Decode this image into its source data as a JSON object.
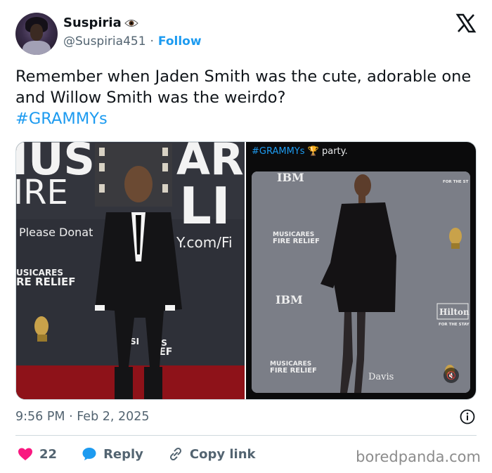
{
  "author": {
    "name": "Suspiria",
    "name_icon": "eye-icon",
    "handle": "@Suspiria451",
    "separator": "·",
    "follow_label": "Follow"
  },
  "tweet": {
    "text": "Remember when Jaden Smith was the cute, adorable one and Willow Smith was the weirdo?",
    "hashtag": "#GRAMMYs"
  },
  "media": {
    "left_photo": {
      "backdrop_texts": [
        "IUS",
        "ARE",
        "IRE",
        "LI",
        "Please Donat",
        "Y.com/Fi",
        "USICARES",
        "RE RELIEF",
        "SI",
        "ES",
        "IEF"
      ]
    },
    "right_photo": {
      "caption_hashtag": "#GRAMMYs",
      "caption_text": "party.",
      "backdrop_texts": [
        "IBM",
        "MUSICARES",
        "FIRE RELIEF",
        "IBM",
        "MUSICARES",
        "FIRE RELIEF",
        "Hilton",
        "FOR THE STAY",
        "FOR THE ST",
        "Davis"
      ],
      "mute_icon": "mute-icon"
    }
  },
  "meta": {
    "timestamp": "9:56 PM · Feb 2, 2025"
  },
  "actions": {
    "like_count": "22",
    "reply_label": "Reply",
    "copy_label": "Copy link"
  },
  "watermark": "boredpanda.com",
  "colors": {
    "accent": "#1d9bf0",
    "like": "#f91880",
    "text": "#0f1419",
    "muted": "#536471"
  }
}
